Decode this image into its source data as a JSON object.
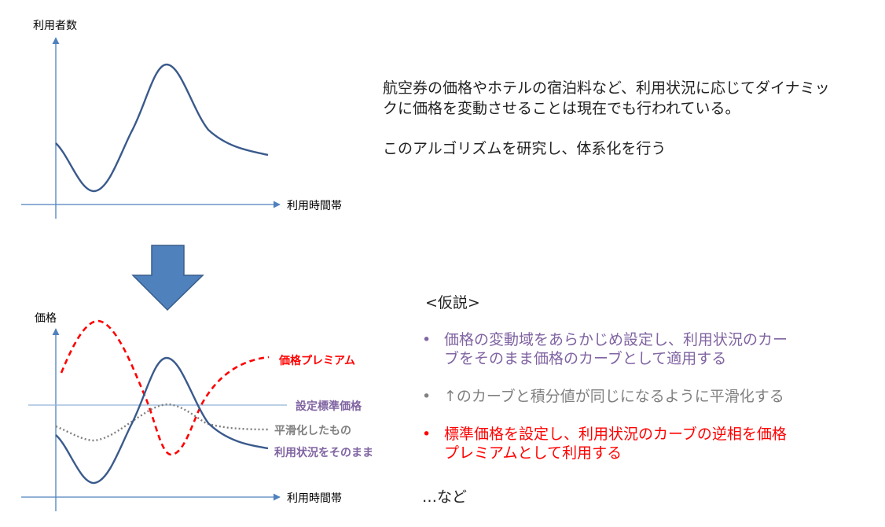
{
  "top_chart": {
    "y_axis_label": "利用者数",
    "x_axis_label": "利用時間帯"
  },
  "bottom_chart": {
    "y_axis_label": "価格",
    "x_axis_label": "利用時間帯",
    "legend": {
      "premium": "価格プレミアム",
      "standard": "設定標準価格",
      "smoothed": "平滑化したもの",
      "raw": "利用状況をそのまま"
    }
  },
  "intro": {
    "line1": "航空券の価格やホテルの宿泊料など、利用状況に応じてダイナミッ",
    "line2": "クに価格を変動させることは現在でも行われている。",
    "line3": "このアルゴリズムを研究し、体系化を行う"
  },
  "hypothesis": {
    "heading": "<仮説>",
    "items": [
      {
        "line1": "価格の変動域をあらかじめ設定し、利用状況のカー",
        "line2": "ブをそのまま価格のカーブとして適用する",
        "color": "#8064a2"
      },
      {
        "line1": "↑のカーブと積分値が同じになるように平滑化する",
        "line2": "",
        "color": "#808080"
      },
      {
        "line1": "標準価格を設定し、利用状況のカーブの逆相を価格",
        "line2": "プレミアムとして利用する",
        "color": "#ff0000"
      }
    ],
    "footer": "…など"
  },
  "colors": {
    "axis": "#4f81bd",
    "curve": "#3a5a8c",
    "premium": "#ff0000",
    "standard": "#95b3d7",
    "smoothed": "#808080",
    "arrow": "#4f81bd",
    "legend_purple": "#8064a2"
  }
}
